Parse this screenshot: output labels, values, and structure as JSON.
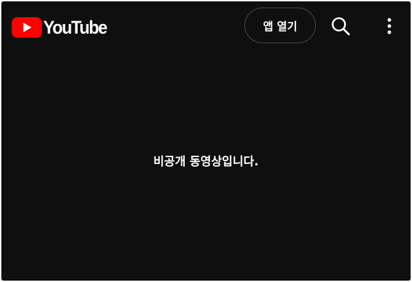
{
  "header": {
    "logo_text": "YouTube",
    "logo_icon": "youtube-play-icon",
    "open_app_label": "앱 열기",
    "search_icon": "search-icon",
    "more_icon": "more-vert-icon"
  },
  "main": {
    "message": "비공개 동영상입니다."
  },
  "colors": {
    "background": "#0f0f0f",
    "brand_red": "#ff0000",
    "text": "#ffffff",
    "button_border": "#4a4a4a"
  }
}
